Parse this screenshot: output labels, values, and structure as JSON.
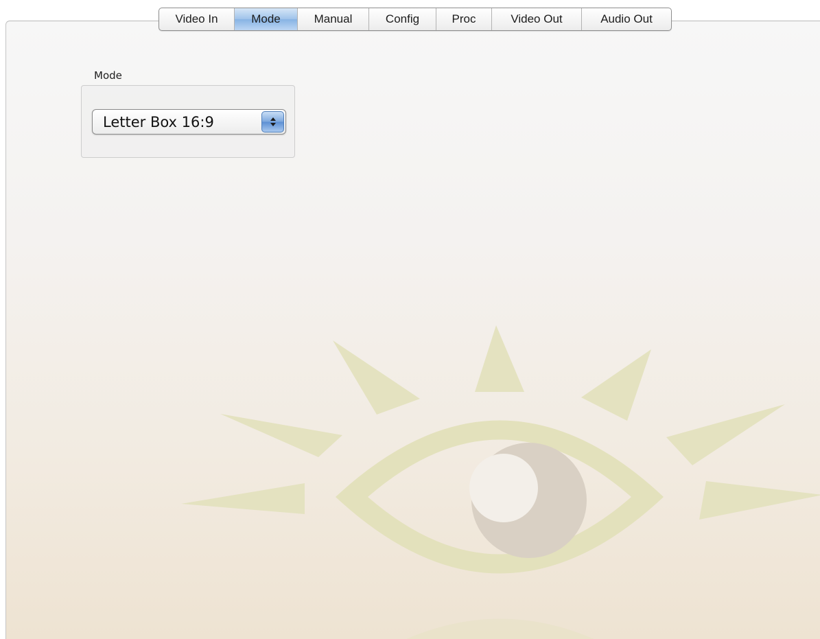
{
  "tabs": [
    {
      "label": "Video In",
      "selected": false
    },
    {
      "label": "Mode",
      "selected": true
    },
    {
      "label": "Manual",
      "selected": false
    },
    {
      "label": "Config",
      "selected": false
    },
    {
      "label": "Proc",
      "selected": false
    },
    {
      "label": "Video Out",
      "selected": false
    },
    {
      "label": "Audio Out",
      "selected": false
    }
  ],
  "mode_group": {
    "label": "Mode",
    "select_value": "Letter Box 16:9",
    "stepper_icon": "up-down-arrows-icon"
  },
  "watermark": {
    "icon": "eye-with-rays-logo",
    "ray_color": "#e4e2c0",
    "ring_color": "#e3e1bc",
    "iris_color": "#d9d0c4"
  }
}
